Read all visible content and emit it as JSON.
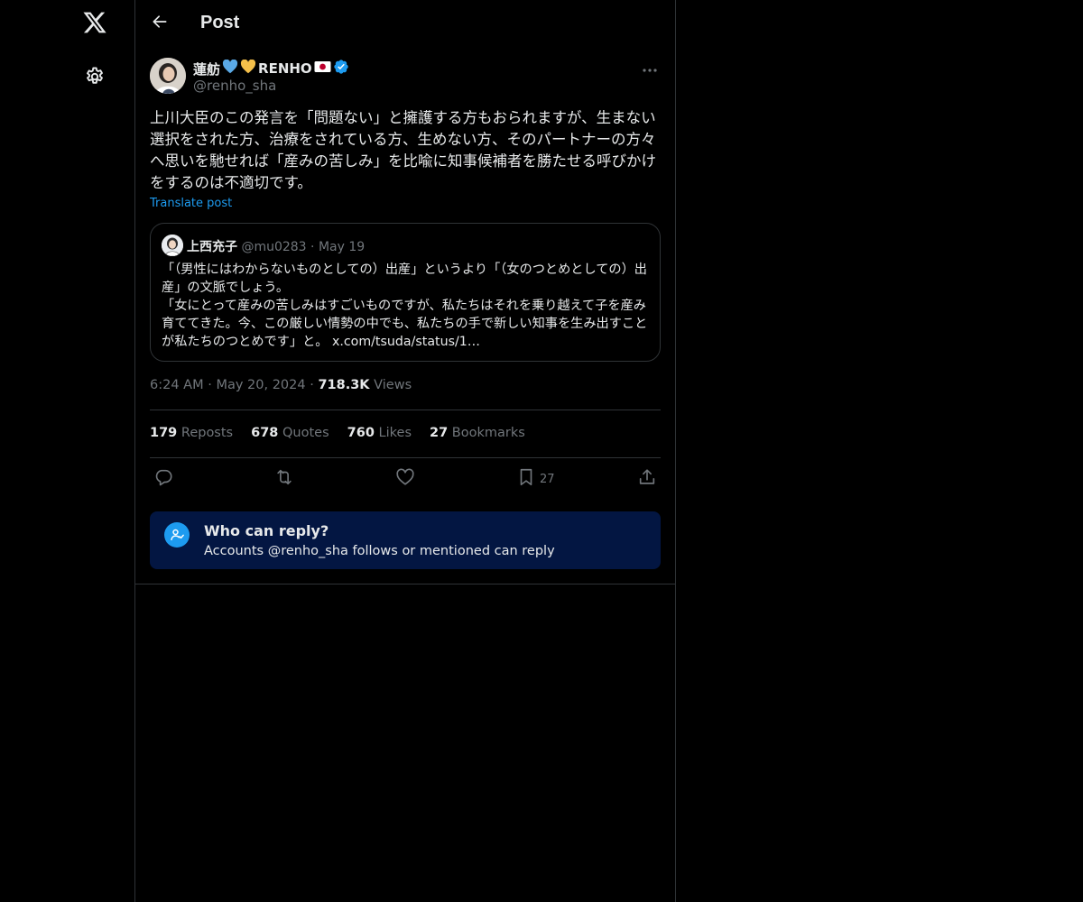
{
  "nav": {
    "logo_icon": "x-logo-icon",
    "settings_icon": "gear-icon"
  },
  "header": {
    "title": "Post",
    "back_icon": "arrow-left-icon"
  },
  "post": {
    "author_name": "蓮舫",
    "author_name_suffix": "RENHO",
    "author_handle": "@renho_sha",
    "verified": true,
    "text": "上川大臣のこの発言を「問題ない」と擁護する方もおられますが、生まない選択をされた方、治療をされている方、生めない方、そのパートナーの方々へ思いを馳せれば「産みの苦しみ」を比喩に知事候補者を勝たせる呼びかけをするのは不適切です。",
    "translate_label": "Translate post",
    "time": "6:24 AM",
    "date": "May 20, 2024",
    "views_count": "718.3K",
    "views_label": "Views"
  },
  "quote": {
    "author_name": "上西充子",
    "author_handle": "@mu0283",
    "date": "May 19",
    "text_line1": "「（男性にはわからないものとしての）出産」というより「（女のつとめとしての）出産」の文脈でしょう。",
    "text_line2": "「女にとって産みの苦しみはすごいものですが、私たちはそれを乗り越えて子を産み育ててきた。今、この厳しい情勢の中でも、私たちの手で新しい知事を生み出すことが私たちのつとめです」と。 x.com/tsuda/status/1…"
  },
  "stats": {
    "reposts_count": "179",
    "reposts_label": "Reposts",
    "quotes_count": "678",
    "quotes_label": "Quotes",
    "likes_count": "760",
    "likes_label": "Likes",
    "bookmarks_count": "27",
    "bookmarks_label": "Bookmarks"
  },
  "actions": {
    "bookmark_count": "27"
  },
  "reply_settings": {
    "title": "Who can reply?",
    "subtitle": "Accounts @renho_sha follows or mentioned can reply"
  },
  "colors": {
    "accent": "#1d9bf0",
    "background": "#000000",
    "reply_box": "#031642",
    "muted": "#71767b"
  }
}
